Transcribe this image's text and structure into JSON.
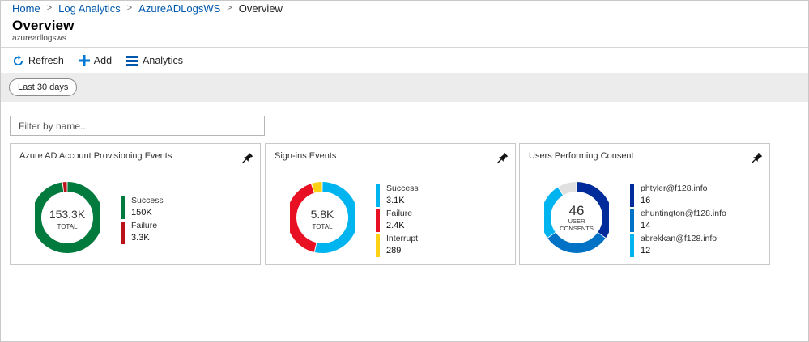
{
  "breadcrumb": [
    {
      "label": "Home"
    },
    {
      "label": "Log Analytics"
    },
    {
      "label": "AzureADLogsWS"
    }
  ],
  "breadcrumb_current": "Overview",
  "page": {
    "title": "Overview",
    "subtitle": "azureadlogsws"
  },
  "toolbar": {
    "refresh": "Refresh",
    "add": "Add",
    "analytics": "Analytics"
  },
  "time_range": "Last 30 days",
  "filter": {
    "placeholder": "Filter by name..."
  },
  "colors": {
    "accent": "#0078d4",
    "green": "#007a3d",
    "red": "#e81123",
    "lightblue": "#00b4f0",
    "yellow": "#fcd116",
    "navy": "#002b9a",
    "midblue": "#0072c6",
    "gray": "#e0e0e0"
  },
  "tiles": [
    {
      "title": "Azure AD Account Provisioning Events",
      "center_value": "153.3K",
      "center_label": "TOTAL",
      "segments": [
        {
          "name": "Success",
          "display": "150K",
          "value": 150000,
          "color": "#007a3d"
        },
        {
          "name": "Failure",
          "display": "3.3K",
          "value": 3300,
          "color": "#ba141a"
        }
      ]
    },
    {
      "title": "Sign-ins Events",
      "center_value": "5.8K",
      "center_label": "TOTAL",
      "segments": [
        {
          "name": "Success",
          "display": "3.1K",
          "value": 3100,
          "color": "#00b4f0"
        },
        {
          "name": "Failure",
          "display": "2.4K",
          "value": 2400,
          "color": "#e81123"
        },
        {
          "name": "Interrupt",
          "display": "289",
          "value": 289,
          "color": "#fcd116"
        }
      ]
    },
    {
      "title": "Users Performing Consent",
      "center_value": "46",
      "center_label": "USER CONSENTS",
      "segments": [
        {
          "name": "phtyler@f128.info",
          "display": "16",
          "value": 16,
          "color": "#002b9a"
        },
        {
          "name": "ehuntington@f128.info",
          "display": "14",
          "value": 14,
          "color": "#0072c6"
        },
        {
          "name": "abrekkan@f128.info",
          "display": "12",
          "value": 12,
          "color": "#00b4f0"
        }
      ],
      "remainder": {
        "value": 4,
        "color": "#e0e0e0"
      }
    }
  ]
}
